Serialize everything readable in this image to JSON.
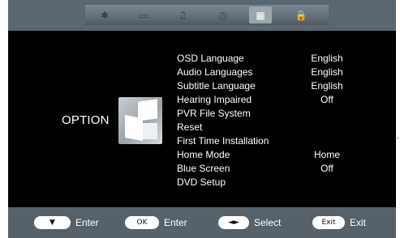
{
  "top_tabs": [
    {
      "name": "picture",
      "icon": "✱",
      "active": false
    },
    {
      "name": "display",
      "icon": "▭",
      "active": false
    },
    {
      "name": "sound",
      "icon": "♫",
      "active": false
    },
    {
      "name": "time",
      "icon": "◷",
      "active": false
    },
    {
      "name": "option",
      "icon": "▦",
      "active": true
    },
    {
      "name": "lock",
      "icon": "🔒",
      "active": false
    }
  ],
  "section_title": "OPTION",
  "menu_items": [
    {
      "label": "OSD Language",
      "value": "English"
    },
    {
      "label": "Audio Languages",
      "value": "English"
    },
    {
      "label": "Subtitle Language",
      "value": "English"
    },
    {
      "label": "Hearing Impaired",
      "value": "Off"
    },
    {
      "label": "PVR File System",
      "value": ""
    },
    {
      "label": "Reset",
      "value": ""
    },
    {
      "label": "First Time Installation",
      "value": ""
    },
    {
      "label": "Home Mode",
      "value": "Home"
    },
    {
      "label": "Blue Screen",
      "value": "Off"
    },
    {
      "label": "DVD Setup",
      "value": ""
    }
  ],
  "hints": [
    {
      "key": "▼",
      "label": "Enter"
    },
    {
      "key": "OK",
      "label": "Enter"
    },
    {
      "key": "◄►",
      "label": "Select"
    },
    {
      "key": "Exit",
      "label": "Exit"
    }
  ],
  "side_mark": ".",
  "colors": {
    "background": "#000000",
    "bar": "#56616a",
    "text": "#ffffff"
  }
}
